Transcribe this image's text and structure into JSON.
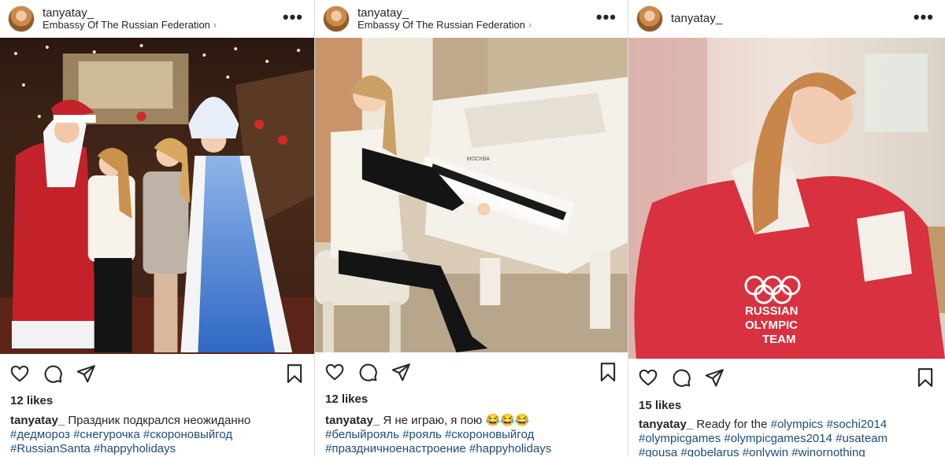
{
  "posts": [
    {
      "username": "tanyatay_",
      "location": "Embassy Of The Russian Federation",
      "likes": "12 likes",
      "caption_user": "tanyatay_",
      "caption_text": "Праздник подкрался неожиданно",
      "hashtags_line1": "#дедмороз #снегурочка #скороновыйгод",
      "hashtags_line2": "#RussianSanta #happyholidays"
    },
    {
      "username": "tanyatay_",
      "location": "Embassy Of The Russian Federation",
      "likes": "12 likes",
      "caption_user": "tanyatay_",
      "caption_text": "Я не играю, я пою 😂😂😂",
      "hashtags_line1": "#белыйрояль #рояль #скороновыйгод",
      "hashtags_line2": "#праздничноенастроение #happyholidays",
      "piano_brand": "МОСКВА"
    },
    {
      "username": "tanyatay_",
      "likes": "15 likes",
      "caption_user": "tanyatay_",
      "caption_text": "Ready for the",
      "caption_tags_inline": "#olympics #sochi2014",
      "hashtags_line1": "#olympicgames #olympicgames2014 #usateam",
      "hashtags_line2": "#gousa #gobelarus #onlywin #winornothing",
      "jacket_text_1": "RUSSIAN",
      "jacket_text_2": "OLYMPIC",
      "jacket_text_3": "TEAM"
    }
  ],
  "ui": {
    "more_glyph": "•••",
    "chevron_glyph": "›"
  },
  "colors": {
    "hashtag": "#1e4b7a",
    "text": "#262626",
    "separator": "#dbdbdb",
    "jacket_red": "#d8313f"
  }
}
